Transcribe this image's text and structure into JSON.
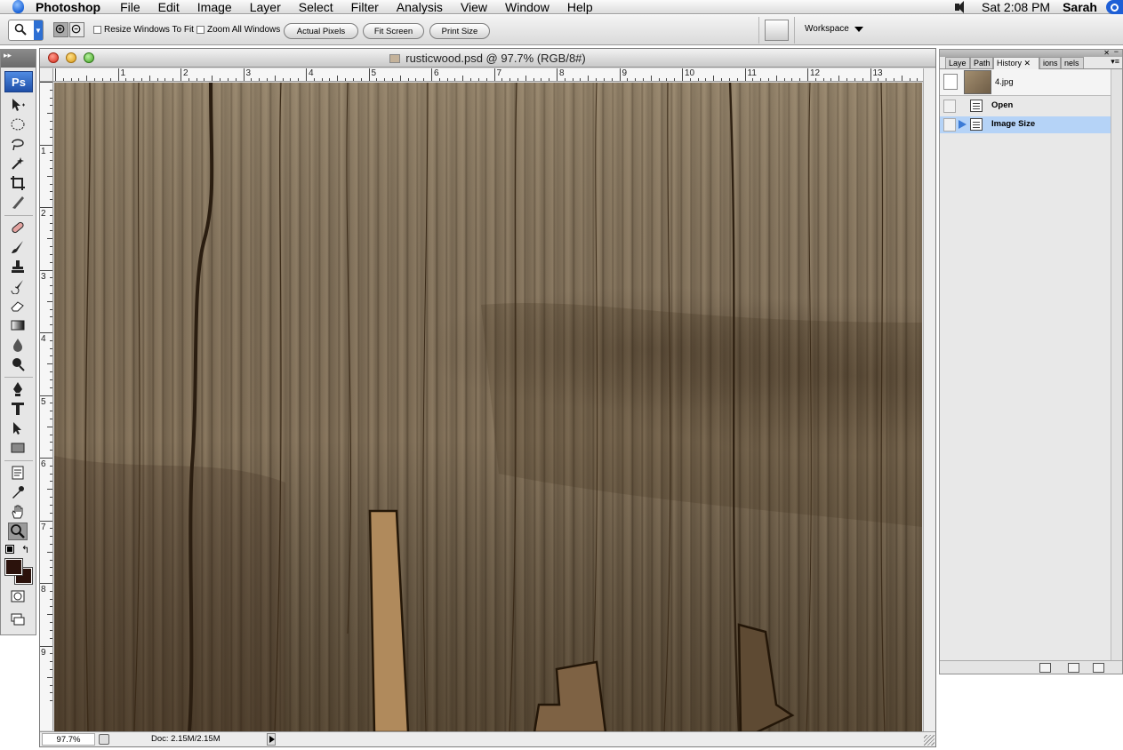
{
  "menubar": {
    "app_name": "Photoshop",
    "items": [
      "File",
      "Edit",
      "Image",
      "Layer",
      "Select",
      "Filter",
      "Analysis",
      "View",
      "Window",
      "Help"
    ],
    "clock": "Sat 2:08 PM",
    "user": "Sarah"
  },
  "options_bar": {
    "resize_windows_label": "Resize Windows To Fit",
    "zoom_all_label": "Zoom All Windows",
    "actual_pixels_label": "Actual Pixels",
    "fit_screen_label": "Fit Screen",
    "print_size_label": "Print Size",
    "workspace_label": "Workspace"
  },
  "toolbox": {
    "logo": "Ps"
  },
  "document": {
    "title": "rusticwood.psd @ 97.7% (RGB/8#)",
    "zoom": "97.7%",
    "doc_size": "Doc: 2.15M/2.15M",
    "ruler_h_labels": [
      "1",
      "2",
      "3",
      "4",
      "5",
      "6",
      "7",
      "8",
      "9",
      "10",
      "11",
      "12",
      "13"
    ],
    "ruler_v_labels": [
      "1",
      "2",
      "3",
      "4",
      "5",
      "6",
      "7",
      "8",
      "9"
    ]
  },
  "history_panel": {
    "tabs": [
      "Laye",
      "Path",
      "History",
      "ions",
      "nels"
    ],
    "snapshot_name": "4.jpg",
    "states": [
      {
        "label": "Open",
        "selected": false
      },
      {
        "label": "Image Size",
        "selected": true
      }
    ]
  },
  "colors": {
    "foreground": "#2b120c",
    "background": "#2b120c",
    "selection": "#b5d3f7",
    "accent": "#2d6fd3"
  }
}
